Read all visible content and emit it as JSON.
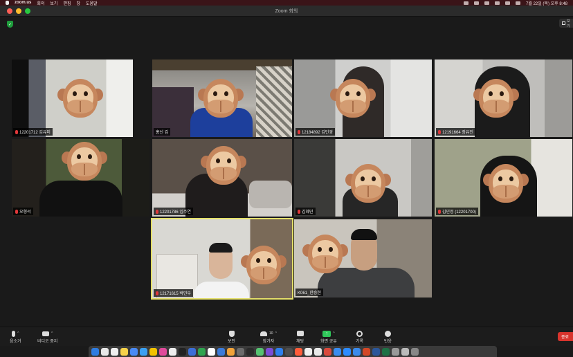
{
  "menubar": {
    "app_name": "zoom.us",
    "items": [
      "회의",
      "보기",
      "편집",
      "창",
      "도움말"
    ],
    "clock": "7월 22일 (목) 오후 8:48"
  },
  "window": {
    "title": "Zoom 회의"
  },
  "view_button": {
    "label": "보기"
  },
  "participants": [
    {
      "name": "12201712 김유미"
    },
    {
      "name": "홍신 김"
    },
    {
      "name": "12184892 김민경"
    },
    {
      "name": "12191664 장유진"
    },
    {
      "name": "오형석"
    },
    {
      "name": "12201786 임주연"
    },
    {
      "name": "김혜민"
    },
    {
      "name": "김민정 (12201700)"
    },
    {
      "name": "12171615 박민우"
    },
    {
      "name": "K061_한승현"
    }
  ],
  "toolbar": {
    "audio_label": "음소거",
    "video_label": "비디오 중지",
    "security_label": "보안",
    "participants_label": "참가자",
    "participants_count": "10",
    "chat_label": "채팅",
    "share_label": "화면 공유",
    "record_label": "기록",
    "reactions_label": "반응",
    "end_label": "종료"
  },
  "colors": {
    "accent_share": "#2fc75a",
    "active_speaker": "#e5e06a",
    "end_button": "#d8342d",
    "muted": "#e0383a"
  }
}
